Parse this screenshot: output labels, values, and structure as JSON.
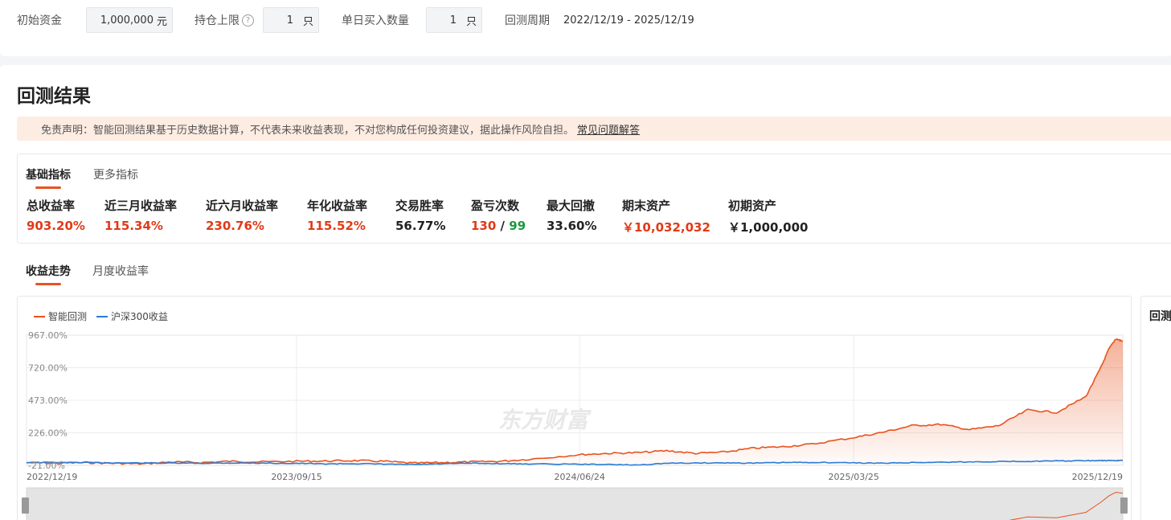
{
  "params": {
    "capital_label": "初始资金",
    "capital_value": "1,000,000",
    "capital_unit": "元",
    "position_label": "持仓上限",
    "position_help_icon": "question-circle-icon",
    "position_value": "1",
    "position_unit": "只",
    "daily_buy_label": "单日买入数量",
    "daily_buy_value": "1",
    "daily_buy_unit": "只",
    "period_label": "回测周期",
    "period_value": "2022/12/19 - 2025/12/19"
  },
  "result": {
    "title": "回测结果",
    "disclaimer": "免责声明：智能回测结果基于历史数据计算，不代表未来收益表现，不对您构成任何投资建议，据此操作风险自担。",
    "faq_link": "常见问题解答"
  },
  "metric_tabs": [
    "基础指标",
    "更多指标"
  ],
  "metrics": {
    "total_return_label": "总收益率",
    "total_return_value": "903.20%",
    "return_3m_label": "近三月收益率",
    "return_3m_value": "115.34%",
    "return_6m_label": "近六月收益率",
    "return_6m_value": "230.76%",
    "annual_label": "年化收益率",
    "annual_value": "115.52%",
    "win_rate_label": "交易胜率",
    "win_rate_value": "56.77%",
    "pl_label": "盈亏次数",
    "profit_count": "130",
    "pl_sep": "/",
    "loss_count": "99",
    "drawdown_label": "最大回撤",
    "drawdown_value": "33.60%",
    "final_asset_label": "期末资产",
    "final_asset_value": "￥10,032,032",
    "initial_asset_label": "初期资产",
    "initial_asset_value": "￥1,000,000"
  },
  "chart_tabs": [
    "收益走势",
    "月度收益率"
  ],
  "right_panel_title": "回测",
  "colors": {
    "accent": "#e8531e",
    "strategy": "#e8531e",
    "benchmark": "#2b7bd6",
    "profit": "#e13a17",
    "loss": "#1a9a3c"
  },
  "chart_data": {
    "type": "line",
    "watermark": "东方财富",
    "legend_position": "top-left",
    "grid": true,
    "yticks": [
      "-21.00%",
      "226.00%",
      "473.00%",
      "720.00%",
      "967.00%"
    ],
    "ylim": [
      -21,
      967
    ],
    "xticks": [
      "2022/12/19",
      "2023/09/15",
      "2024/06/24",
      "2025/03/25",
      "2025/12/19"
    ],
    "x": [
      "2022/12/19",
      "2023/01/17",
      "2023/02/15",
      "2023/03/16",
      "2023/04/14",
      "2023/05/13",
      "2023/06/11",
      "2023/07/10",
      "2023/08/08",
      "2023/09/15",
      "2023/10/14",
      "2023/11/12",
      "2023/12/11",
      "2024/01/09",
      "2024/02/07",
      "2024/03/07",
      "2024/04/05",
      "2024/05/04",
      "2024/06/24",
      "2024/07/23",
      "2024/08/21",
      "2024/09/19",
      "2024/10/18",
      "2024/11/16",
      "2024/12/15",
      "2025/01/13",
      "2025/02/11",
      "2025/03/25",
      "2025/04/23",
      "2025/05/22",
      "2025/06/20",
      "2025/07/19",
      "2025/08/17",
      "2025/09/15",
      "2025/10/14",
      "2025/11/12",
      "2025/11/27",
      "2025/12/05",
      "2025/12/12",
      "2025/12/19"
    ],
    "series": [
      {
        "name": "智能回测",
        "values": [
          0,
          -5,
          0,
          -5,
          -10,
          5,
          0,
          10,
          5,
          10,
          12,
          15,
          10,
          -5,
          0,
          5,
          10,
          25,
          60,
          70,
          75,
          90,
          70,
          80,
          110,
          120,
          140,
          190,
          230,
          280,
          290,
          250,
          280,
          400,
          380,
          500,
          720,
          860,
          940,
          920
        ]
      },
      {
        "name": "沪深300收益",
        "values": [
          0,
          2,
          0,
          -2,
          -3,
          -4,
          -5,
          -3,
          -4,
          -6,
          -10,
          -8,
          -12,
          -15,
          -10,
          -5,
          -8,
          -10,
          -12,
          -15,
          -18,
          -5,
          -3,
          -2,
          -4,
          0,
          2,
          -2,
          -5,
          0,
          3,
          5,
          8,
          10,
          12,
          14,
          15,
          15,
          15,
          16
        ]
      }
    ]
  }
}
